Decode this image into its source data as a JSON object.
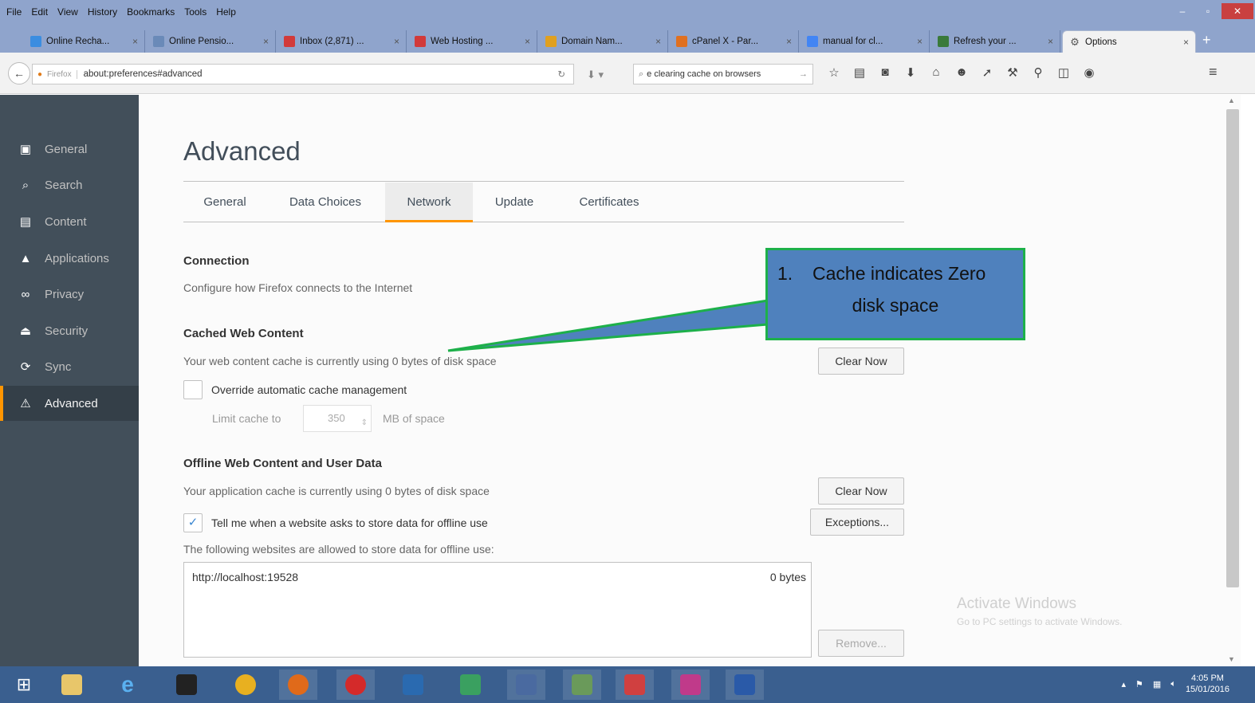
{
  "menubar": {
    "items": [
      "File",
      "Edit",
      "View",
      "History",
      "Bookmarks",
      "Tools",
      "Help"
    ]
  },
  "window_controls": {
    "minimize": "–",
    "maximize": "▫",
    "close": "✕"
  },
  "tabs": [
    {
      "title": "Online Recha...",
      "favicon_color": "#3b8de0"
    },
    {
      "title": "Online Pensio...",
      "favicon_color": "#6a8ab8"
    },
    {
      "title": "Inbox (2,871) ...",
      "favicon_color": "#d23a3a"
    },
    {
      "title": "Web Hosting ...",
      "favicon_color": "#d23a3a"
    },
    {
      "title": "Domain Nam...",
      "favicon_color": "#e0a020"
    },
    {
      "title": "cPanel X - Par...",
      "favicon_color": "#e07020"
    },
    {
      "title": "manual for cl...",
      "favicon_color": "#4285f4"
    },
    {
      "title": "Refresh your ...",
      "favicon_color": "#3a7a3a"
    },
    {
      "title": "Options",
      "favicon_color": "#777777",
      "active": true
    }
  ],
  "navbar": {
    "brand": "Firefox",
    "url": "about:preferences#advanced",
    "search_text": "e clearing cache on browsers"
  },
  "sidebar": {
    "items": [
      {
        "label": "General",
        "icon": "general-icon",
        "glyph": "▣"
      },
      {
        "label": "Search",
        "icon": "search-icon",
        "glyph": "🔍︎"
      },
      {
        "label": "Content",
        "icon": "content-icon",
        "glyph": "▤"
      },
      {
        "label": "Applications",
        "icon": "applications-icon",
        "glyph": "▲"
      },
      {
        "label": "Privacy",
        "icon": "privacy-icon",
        "glyph": "∞"
      },
      {
        "label": "Security",
        "icon": "security-icon",
        "glyph": "⏏"
      },
      {
        "label": "Sync",
        "icon": "sync-icon",
        "glyph": "⟳"
      },
      {
        "label": "Advanced",
        "icon": "advanced-icon",
        "glyph": "⚠",
        "selected": true
      }
    ]
  },
  "main": {
    "title": "Advanced",
    "subtabs": [
      "General",
      "Data Choices",
      "Network",
      "Update",
      "Certificates"
    ],
    "selected_subtab": "Network",
    "connection": {
      "heading": "Connection",
      "desc": "Configure how Firefox connects to the Internet"
    },
    "cached": {
      "heading": "Cached Web Content",
      "desc": "Your web content cache is currently using 0 bytes of disk space",
      "clear_button": "Clear Now",
      "override_label": "Override automatic cache management",
      "override_checked": false,
      "limit_label": "Limit cache to",
      "limit_value": "350",
      "limit_unit": "MB of space"
    },
    "offline": {
      "heading": "Offline Web Content and User Data",
      "desc": "Your application cache is currently using 0 bytes of disk space",
      "clear_button": "Clear Now",
      "tell_me_label": "Tell me when a website asks to store data for offline use",
      "tell_me_checked": true,
      "exceptions_button": "Exceptions...",
      "list_label": "The following websites are allowed to store data for offline use:",
      "sites": [
        {
          "url": "http://localhost:19528",
          "size": "0 bytes"
        }
      ],
      "remove_button": "Remove..."
    }
  },
  "watermark": {
    "line1": "Activate Windows",
    "line2": "Go to PC settings to activate Windows."
  },
  "callout": {
    "number": "1.",
    "line1": "Cache indicates Zero",
    "line2": "disk space",
    "border_color": "#1db04a",
    "fill_color": "#4f81bd"
  },
  "taskbar": {
    "apps": [
      {
        "name": "start-icon",
        "color": "#ffffff"
      },
      {
        "name": "file-explorer-icon",
        "color": "#e8c66a"
      },
      {
        "name": "internet-explorer-icon",
        "color": "#3aa0e0"
      },
      {
        "name": "command-prompt-icon",
        "color": "#222222"
      },
      {
        "name": "chrome-icon",
        "color": "#e8b020"
      },
      {
        "name": "firefox-icon",
        "color": "#e06a1a"
      },
      {
        "name": "opera-icon",
        "color": "#d42a2a"
      },
      {
        "name": "virtualbox-icon",
        "color": "#2a6ab0"
      },
      {
        "name": "media-app-icon",
        "color": "#3aa060"
      },
      {
        "name": "remote-desktop-icon",
        "color": "#4a6aa0"
      },
      {
        "name": "task-manager-icon",
        "color": "#6a9a5a"
      },
      {
        "name": "snipping-tool-icon",
        "color": "#d04040"
      },
      {
        "name": "paint-icon",
        "color": "#c03a8a"
      },
      {
        "name": "word-icon",
        "color": "#2a5aa8"
      }
    ],
    "time": "4:05 PM",
    "date": "15/01/2016"
  }
}
